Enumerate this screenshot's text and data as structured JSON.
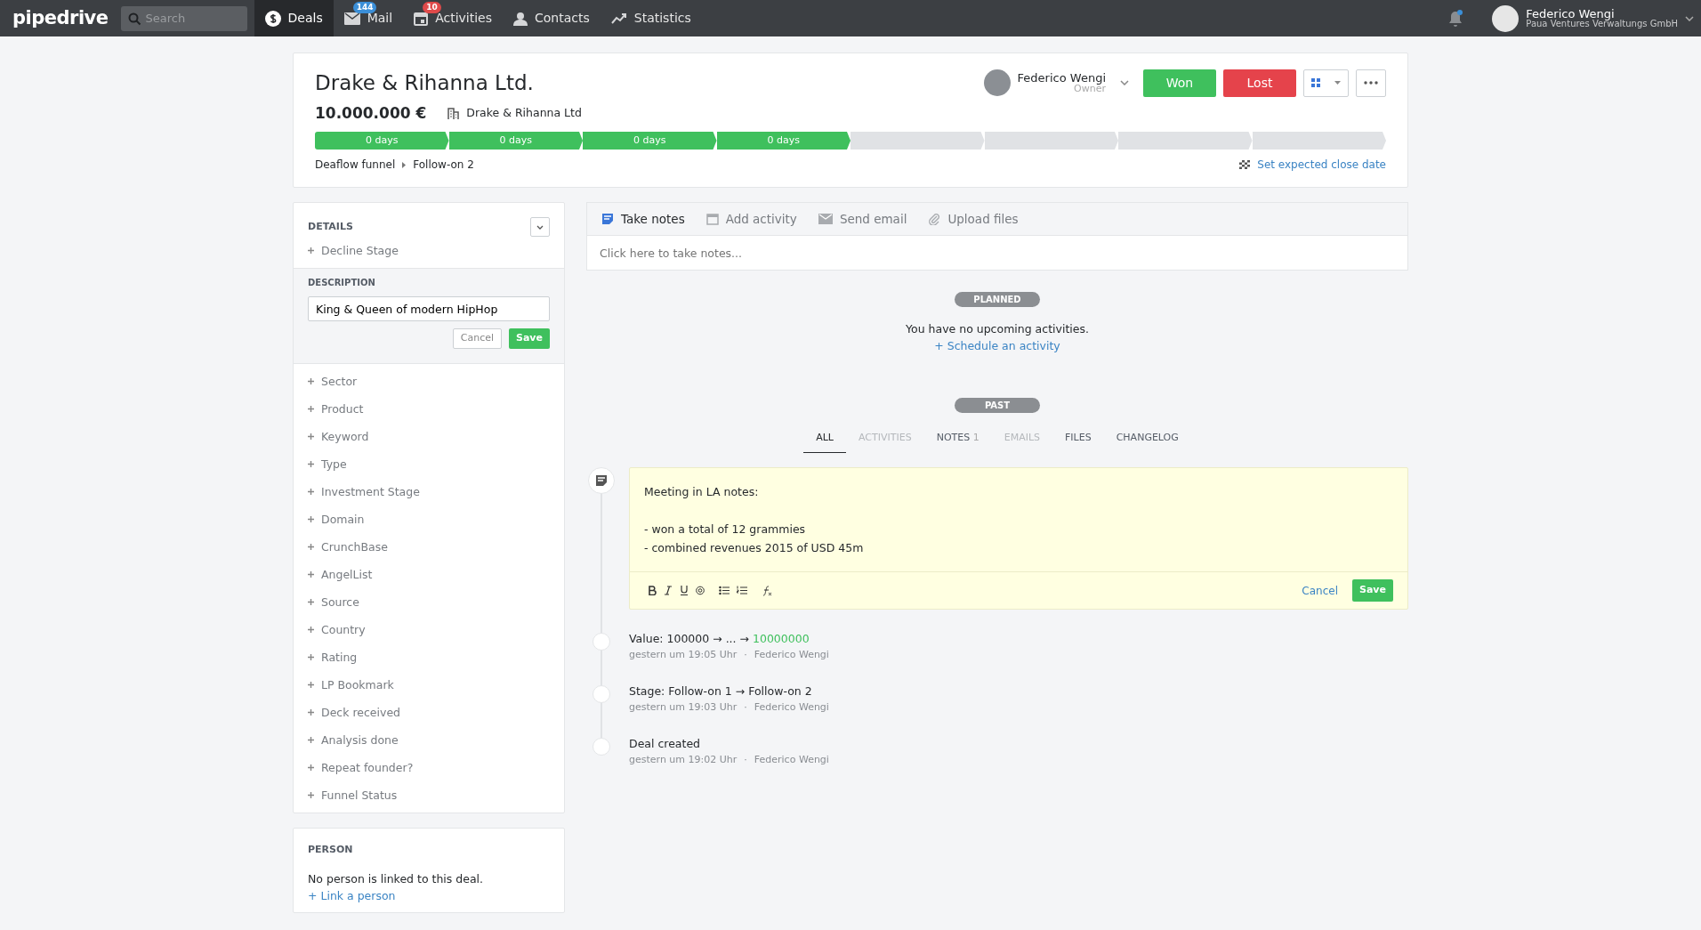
{
  "topbar": {
    "logo": "pipedrive",
    "search": {
      "placeholder": "Search"
    },
    "nav": [
      {
        "label": "Deals",
        "selected": true
      },
      {
        "label": "Mail",
        "badge": "144",
        "color": "#3b8fd8",
        "selected": false
      },
      {
        "label": "Activities",
        "badge": "10",
        "color": "#e04a4a",
        "selected": false
      },
      {
        "label": "Contacts",
        "selected": false
      },
      {
        "label": "Statistics",
        "selected": false
      }
    ],
    "user": {
      "name": "Federico Wengi",
      "company": "Paua Ventures Verwaltungs GmbH"
    }
  },
  "deal": {
    "title": "Drake & Rihanna Ltd.",
    "value": "10.000.000 €",
    "organization": "Drake & Rihanna Ltd",
    "owner": {
      "name": "Federico Wengi",
      "role": "Owner"
    },
    "won_label": "Won",
    "lost_label": "Lost",
    "stages": [
      {
        "label": "0 days",
        "done": true
      },
      {
        "label": "0 days",
        "done": true
      },
      {
        "label": "0 days",
        "done": true
      },
      {
        "label": "0 days",
        "done": true
      },
      {
        "done": false
      },
      {
        "done": false
      },
      {
        "done": false
      },
      {
        "done": false
      }
    ],
    "breadcrumb": [
      "Deaflow funnel",
      "Follow-on 2"
    ],
    "close_date_link": "Set expected close date"
  },
  "details": {
    "heading": "DETAILS",
    "first_field": "Decline Stage",
    "description": {
      "label": "DESCRIPTION",
      "value": "King & Queen of modern HipHop",
      "cancel": "Cancel",
      "save": "Save"
    },
    "fields": [
      "Sector",
      "Product",
      "Keyword",
      "Type",
      "Investment Stage",
      "Domain",
      "CrunchBase",
      "AngelList",
      "Source",
      "Country",
      "Rating",
      "LP Bookmark",
      "Deck received",
      "Analysis done",
      "Repeat founder?",
      "Funnel Status"
    ]
  },
  "person": {
    "heading": "PERSON",
    "text": "No person is linked to this deal.",
    "link": "+ Link a person"
  },
  "composer": {
    "tabs": [
      {
        "label": "Take notes",
        "selected": true
      },
      {
        "label": "Add activity",
        "selected": false
      },
      {
        "label": "Send email",
        "selected": false
      },
      {
        "label": "Upload files",
        "selected": false
      }
    ],
    "placeholder": "Click here to take notes..."
  },
  "planned": {
    "pill": "PLANNED",
    "text": "You have no upcoming activities.",
    "link": "+ Schedule an activity"
  },
  "past": {
    "pill": "PAST",
    "filters": [
      {
        "label": "ALL",
        "selected": true,
        "disabled": false
      },
      {
        "label": "ACTIVITIES",
        "selected": false,
        "disabled": true
      },
      {
        "label": "NOTES",
        "count": "1",
        "selected": false,
        "disabled": false
      },
      {
        "label": "EMAILS",
        "selected": false,
        "disabled": true
      },
      {
        "label": "FILES",
        "selected": false,
        "disabled": false
      },
      {
        "label": "CHANGELOG",
        "selected": false,
        "disabled": false
      }
    ]
  },
  "note_editor": {
    "heading": "Meeting in LA notes:",
    "lines": [
      "- won a total of 12 grammies",
      "- combined revenues 2015 of USD 45m"
    ],
    "cancel": "Cancel",
    "save": "Save"
  },
  "changelog": [
    {
      "text": "Value: 100000 → ... →",
      "highlight": "10000000",
      "time": "gestern um 19:05 Uhr",
      "separator": "·",
      "author": "Federico Wengi"
    },
    {
      "text": "Stage: Follow-on 1 → Follow-on 2",
      "time": "gestern um 19:03 Uhr",
      "separator": "·",
      "author": "Federico Wengi"
    },
    {
      "text": "Deal created",
      "time": "gestern um 19:02 Uhr",
      "separator": "·",
      "author": "Federico Wengi"
    }
  ]
}
